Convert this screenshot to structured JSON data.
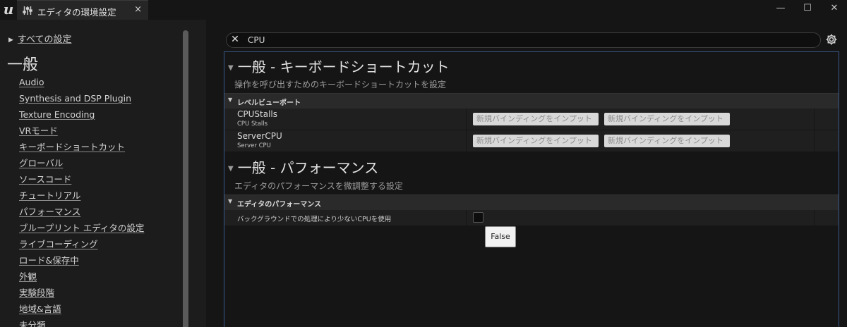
{
  "app": {
    "logo_text": "u",
    "tab_title": "エディタの環境設定",
    "tab_close": "×",
    "window_controls": {
      "minimize": "—",
      "maximize": "☐",
      "close": "✕"
    }
  },
  "sidebar": {
    "all_settings": "すべての設定",
    "section_heading": "一般",
    "items": [
      "Audio",
      "Synthesis and DSP Plugin",
      "Texture Encoding",
      "VRモード",
      "キーボードショートカット",
      "グローバル",
      "ソースコード",
      "チュートリアル",
      "パフォーマンス",
      "ブループリント エディタの設定",
      "ライブコーディング",
      "ロード&保存中",
      "外観",
      "実験段階",
      "地域&言語",
      "未分類"
    ]
  },
  "search": {
    "clear_glyph": "✕",
    "value": "CPU"
  },
  "groups": [
    {
      "title": "一般 - キーボードショートカット",
      "description": "操作を呼び出すためのキーボードショートカットを設定",
      "category": "レベルビューポート",
      "rows": [
        {
          "name": "CPUStalls",
          "sub": "CPU Stalls",
          "binding1": "新規バインディングをインプット",
          "binding2": "新規バインディングをインプット"
        },
        {
          "name": "ServerCPU",
          "sub": "Server CPU",
          "binding1": "新規バインディングをインプット",
          "binding2": "新規バインディングをインプット"
        }
      ]
    },
    {
      "title": "一般 - パフォーマンス",
      "description": "エディタのパフォーマンスを微調整する設定",
      "category": "エディタのパフォーマンス",
      "rows": [
        {
          "label": "バックグラウンドでの処理により少ないCPUを使用",
          "checked": false
        }
      ]
    }
  ],
  "tooltip": {
    "text": "False"
  },
  "colors": {
    "accent_border": "#3a5a8a",
    "background": "#151515",
    "sidebar": "#1c1c1c"
  }
}
